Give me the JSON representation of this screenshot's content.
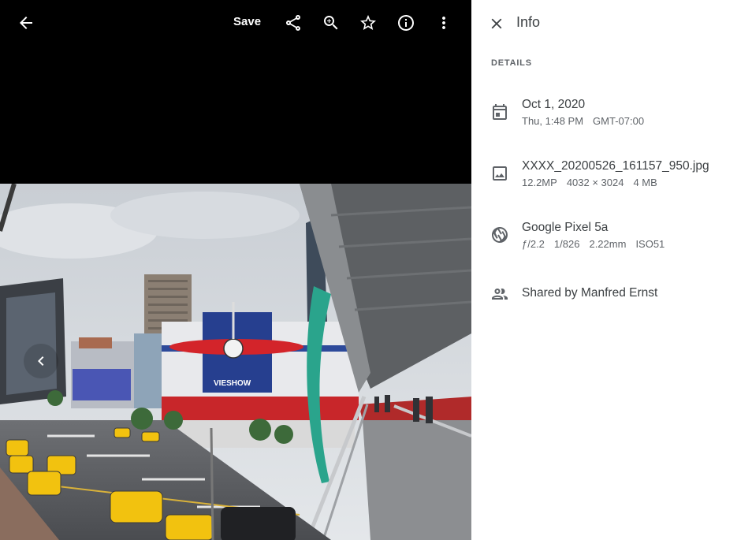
{
  "toolbar": {
    "save_label": "Save",
    "icons": [
      "back-arrow-icon",
      "share-icon",
      "zoom-in-icon",
      "star-icon",
      "info-icon",
      "more-vert-icon"
    ]
  },
  "viewer": {
    "prev_icon": "chevron-left-icon",
    "photo_signage": {
      "mall_sign": "VIESHOW"
    }
  },
  "info_panel": {
    "title": "Info",
    "section_label": "DETAILS",
    "date": {
      "primary": "Oct 1, 2020",
      "day_time": "Thu, 1:48 PM",
      "timezone": "GMT-07:00"
    },
    "file": {
      "name": "XXXX_20200526_161157_950.jpg",
      "megapixels": "12.2MP",
      "resolution": "4032 × 3024",
      "size": "4 MB"
    },
    "camera": {
      "model": "Google Pixel 5a",
      "aperture": "ƒ/2.2",
      "shutter": "1/826",
      "focal": "2.22mm",
      "iso": "ISO51"
    },
    "shared": {
      "label": "Shared by Manfred Ernst"
    }
  },
  "colors": {
    "viewer_bg": "#000000",
    "panel_bg": "#ffffff",
    "text_primary": "#3c4043",
    "text_secondary": "#5f6368"
  }
}
